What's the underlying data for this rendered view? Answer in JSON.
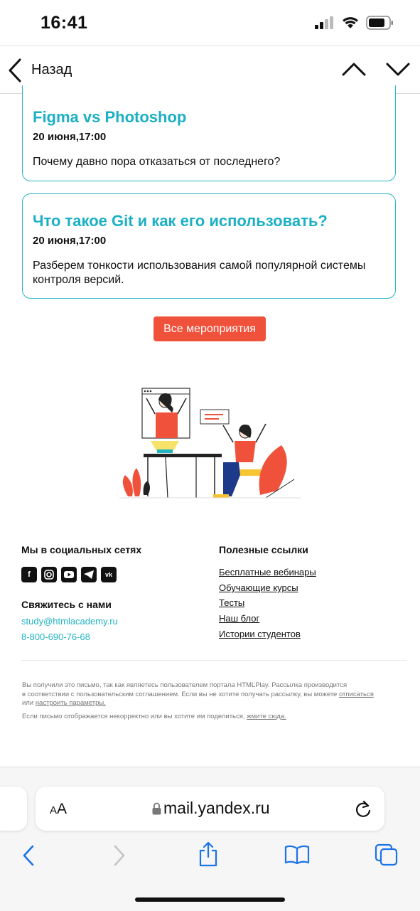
{
  "status_bar": {
    "time": "16:41"
  },
  "nav": {
    "back_label": "Назад"
  },
  "cards": [
    {
      "title": "Figma vs Photoshop",
      "date": "20 июня,17:00",
      "description": "Почему давно пора отказаться от последнего?"
    },
    {
      "title": "Что такое Git и как его использовать?",
      "date": "20 июня,17:00",
      "description": "Разберем тонкости использования самой популярной системы контроля версий."
    }
  ],
  "cta": {
    "label": "Все мероприятия"
  },
  "footer": {
    "social_title": "Мы в социальных сетях",
    "social_icons": [
      "facebook-icon",
      "instagram-icon",
      "youtube-icon",
      "telegram-icon",
      "vk-icon"
    ],
    "contact_title": "Свяжитесь с нами",
    "email": "study@htmlacademy.ru",
    "phone": "8-800-690-76-68",
    "links_title": "Полезные ссылки",
    "links": [
      "Бесплатные вебинары",
      "Обучающие курсы",
      "Тесты",
      "Наш блог",
      "Истории студентов"
    ],
    "legal_1a": "Вы получили это письмо, так как являетесь пользователем портала HTMLPlay. Рассылка производится",
    "legal_1b": "в соответствии с пользовательским соглашением. Если вы не хотите получать рассылку, вы можете",
    "legal_unsubscribe": "отписаться",
    "legal_or": "или",
    "legal_settings": "настроить параметры.",
    "legal_2": "Если письмо отображается некорректно или вы хотите им поделиться,",
    "legal_here": "жмите сюда."
  },
  "browser": {
    "aa": "AA",
    "url": "mail.yandex.ru"
  },
  "colors": {
    "accent": "#1bb0c4",
    "cta": "#f0513a"
  }
}
